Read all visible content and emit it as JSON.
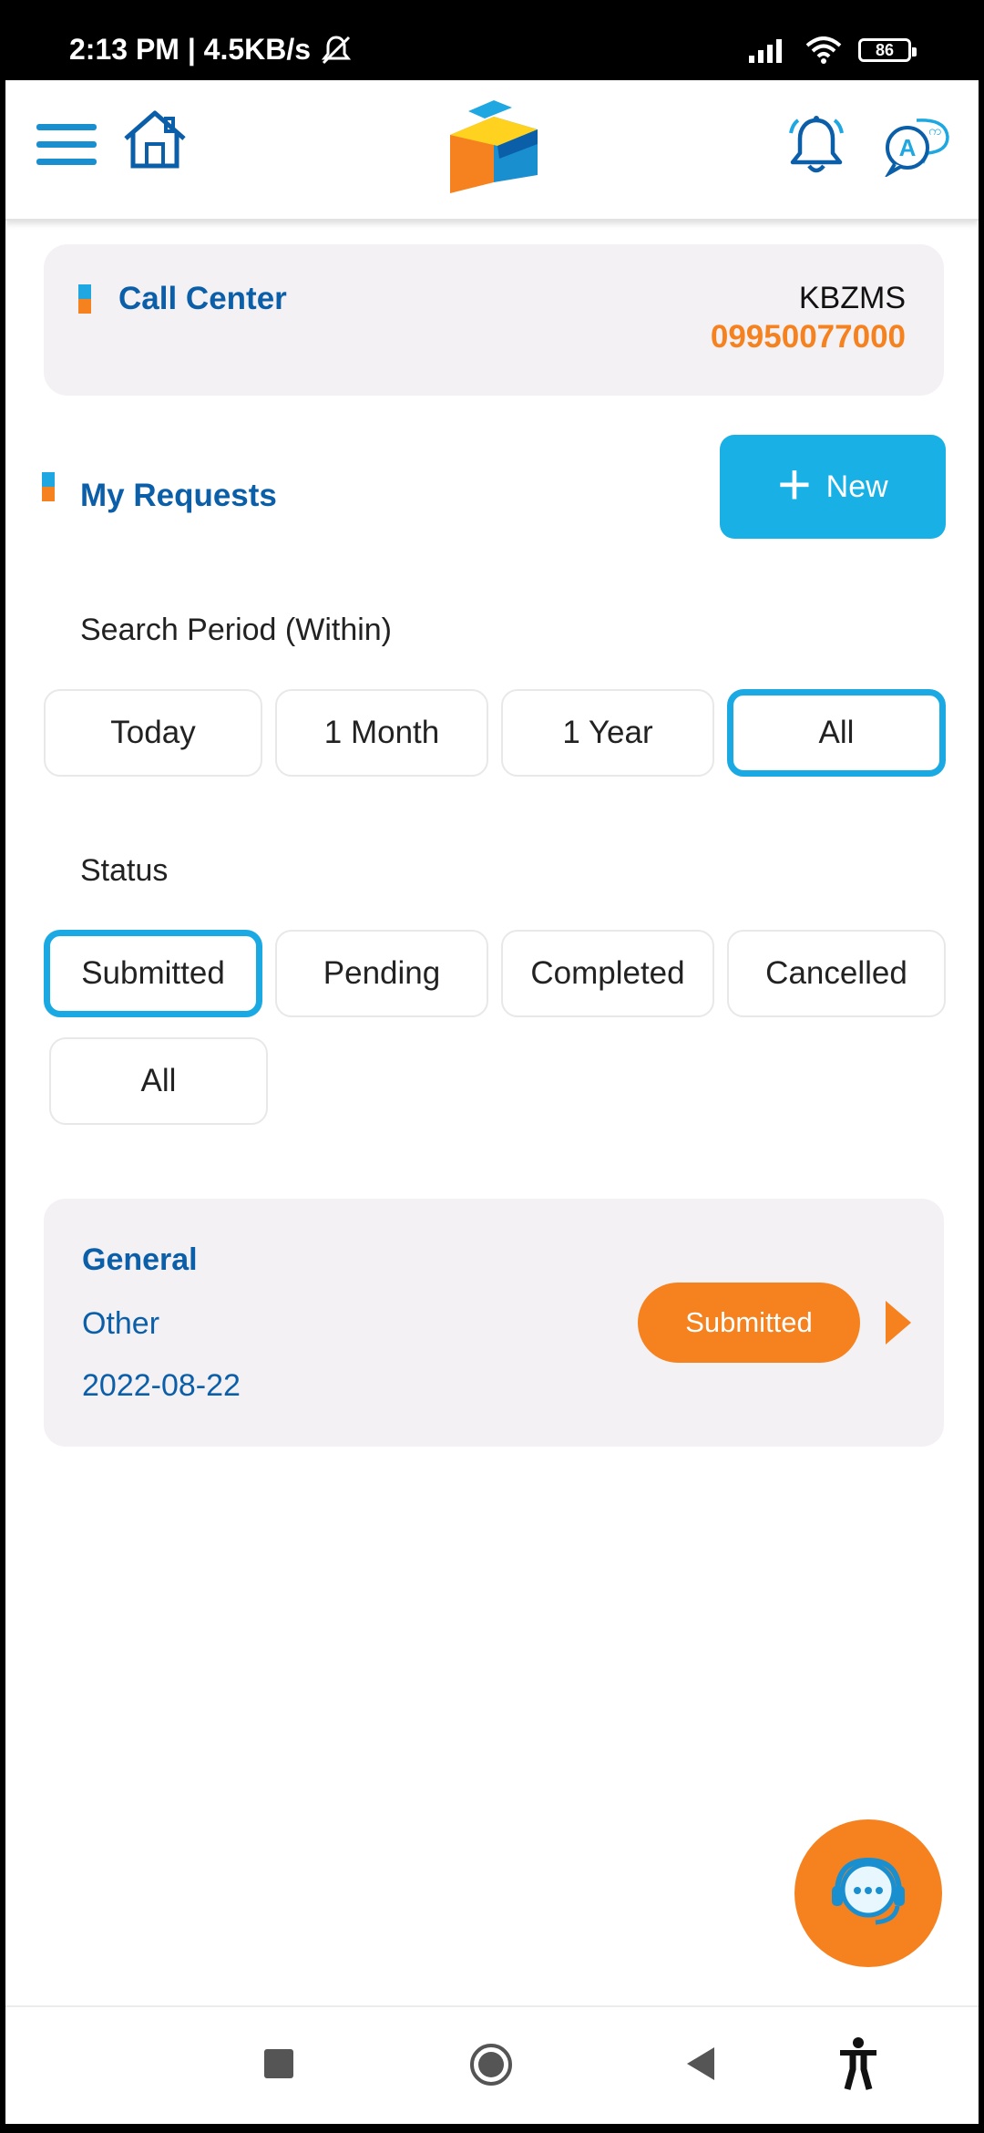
{
  "status_bar": {
    "time_speed": "2:13 PM | 4.5KB/s",
    "battery": "86"
  },
  "header": {
    "menu_icon": "hamburger-menu-icon",
    "home_icon": "home-icon",
    "logo": "box-logo",
    "notification_icon": "bell-icon",
    "language_icon": "language-chat-icon"
  },
  "call_center": {
    "title": "Call Center",
    "name": "KBZMS",
    "phone": "09950077000"
  },
  "requests": {
    "title": "My Requests",
    "new_button_label": "New"
  },
  "search_period": {
    "label": "Search Period (Within)",
    "options": [
      "Today",
      "1 Month",
      "1 Year",
      "All"
    ],
    "selected": "All"
  },
  "status_filter": {
    "label": "Status",
    "options": [
      "Submitted",
      "Pending",
      "Completed",
      "Cancelled",
      "All"
    ],
    "selected": "Submitted"
  },
  "request_items": [
    {
      "category": "General",
      "subcategory": "Other",
      "date": "2022-08-22",
      "status": "Submitted"
    }
  ],
  "colors": {
    "primary_blue": "#19b0e6",
    "text_blue": "#0b5ea8",
    "orange": "#f5821f",
    "card_bg": "#f4f1f4"
  }
}
